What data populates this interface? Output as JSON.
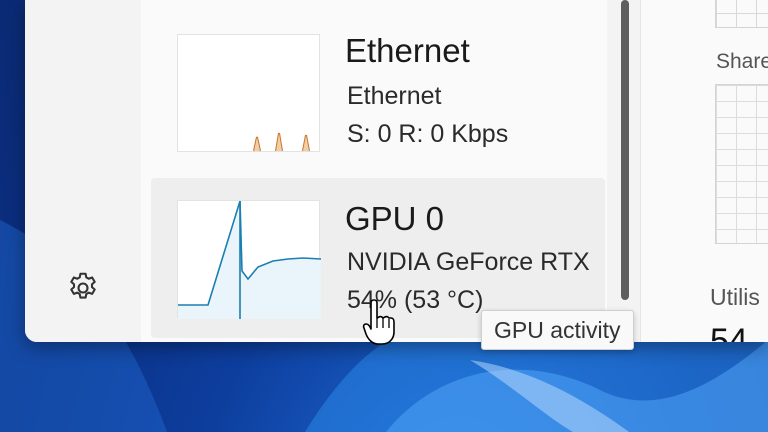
{
  "nav": {
    "settings_icon": "gear-icon"
  },
  "items": [
    {
      "title": "Ethernet",
      "subtitle": "Ethernet",
      "stat": "S: 0 R: 0 Kbps",
      "graph_color": "#c7742a"
    },
    {
      "title": "GPU 0",
      "subtitle": "NVIDIA GeForce RTX",
      "stat": "54% (53 °C)",
      "graph_color": "#1a7fb0",
      "selected": true
    }
  ],
  "detail": {
    "shared_label": "Share",
    "utilisation_label": "Utilis",
    "utilisation_value": "54"
  },
  "tooltip": {
    "text": "GPU activity"
  },
  "colors": {
    "window_bg": "#f3f3f3",
    "accent_gpu": "#1a7fb0",
    "accent_net": "#c7742a",
    "desktop": "#0d3e9e"
  }
}
